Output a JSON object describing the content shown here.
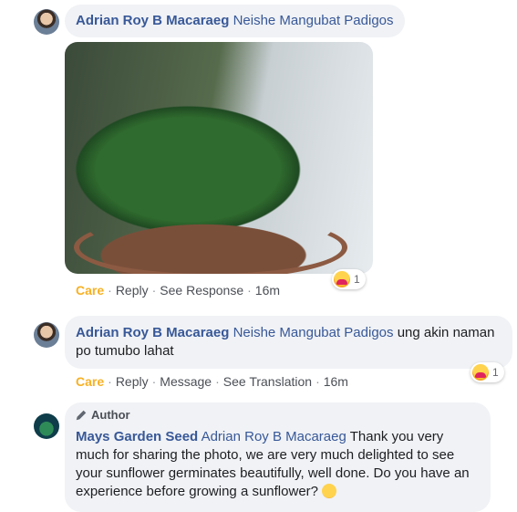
{
  "comment1": {
    "author": "Adrian Roy B Macaraeg",
    "tag": "Neishe Mangubat Padigos",
    "photo_alt": "Sunflower seedlings in a pot",
    "actions": [
      "Care",
      "Reply",
      "See Response",
      "16m"
    ],
    "reaction_count": "1"
  },
  "comment2": {
    "author": "Adrian Roy B Macaraeg",
    "tag": "Neishe Mangubat Padigos",
    "text": "ung akin naman po tumubo lahat",
    "actions": [
      "Care",
      "Reply",
      "Message",
      "See Translation",
      "16m"
    ],
    "reaction_count": "1"
  },
  "comment3": {
    "badge": "Author",
    "author": "Mays Garden Seed",
    "tag": "Adrian Roy B Macaraeg",
    "text": "Thank you very much for sharing the photo, we are very much delighted to see your sunflower germinates beautifully, well done. Do you have an experience before growing a sunflower?"
  }
}
